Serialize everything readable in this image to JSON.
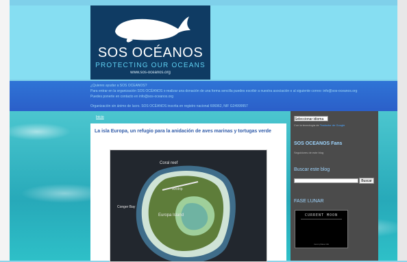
{
  "logo": {
    "title": "SOS OCÉANOS",
    "subtitle": "PROTECTING OUR OCEANS",
    "url": "www.sos-oceanos.org"
  },
  "info": {
    "line1": "¿Quieres ayudar a SOS OCEANOS?",
    "line2": "Para entrar en la organización SOS OCÉANOS o realizar una donación de una forma sencilla puedes escribir a nuestra asociación o al siguiente correo: info@sos-oceanos.org",
    "line3": "Puedes ponerte en contacto en info@sos-oceanos.org",
    "line4": "Organización sin ánimo de lucro. SOS OCÉANOS inscrita en registro nacional 606962, NIF G24999957"
  },
  "post": {
    "top_link": "Inicio",
    "title": "La isla Europa, un refugio para la anidación de aves marinas y tortugas verde",
    "image_labels": {
      "label1": "Coral reef",
      "label2": "Airstrip",
      "label3": "Europa Island",
      "label4": "Conger Bay"
    }
  },
  "sidebar": {
    "language_select": "Seleccionar idioma",
    "language_credit_prefix": "Con la tecnología de",
    "language_credit_link": "Traductor de Google",
    "fans_title": "SOS OCEANOS Fans",
    "fans_sub": "Seguidores de este blog",
    "search_title": "Buscar este blog",
    "search_button": "Buscar",
    "moon_title": "FASE LUNAR",
    "moon_label": "CURRENT MOON",
    "moon_footer": "moon phase info"
  }
}
